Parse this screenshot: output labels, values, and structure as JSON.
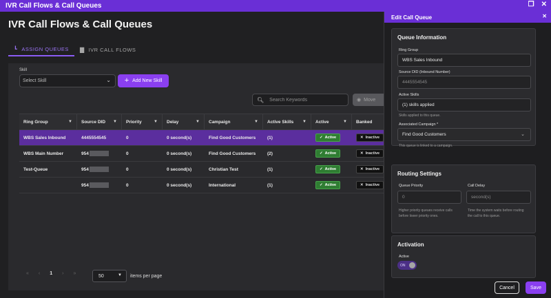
{
  "window": {
    "title": "IVR Call Flows & Call Queues",
    "restore_icon": "restore-icon",
    "close_icon": "close-icon"
  },
  "page": {
    "title": "IVR Call Flows & Call Queues"
  },
  "tabs": [
    {
      "label": "ASSIGN QUEUES",
      "icon": "chart-icon",
      "active": true
    },
    {
      "label": "IVR CALL FLOWS",
      "icon": "bar-chart-icon",
      "active": false
    }
  ],
  "filters": {
    "skill_label": "Skill",
    "skill_placeholder": "Select Skill",
    "add_skill_label": "Add New Skill",
    "search_placeholder": "Search Keywords",
    "partial_button_label": "Move"
  },
  "table": {
    "columns": [
      "Ring Group",
      "Source DID",
      "Priority",
      "Delay",
      "Campaign",
      "Active Skills",
      "Active",
      "Banked"
    ],
    "rows": [
      {
        "ring_group": "WBS Sales Inbound",
        "source_did": "4445554545",
        "priority": "0",
        "delay": "0 second(s)",
        "campaign": "Find Good Customers",
        "active_skills": "(1)",
        "active": "Active",
        "banked": "Inactive",
        "selected": true,
        "masked": false
      },
      {
        "ring_group": "WBS Main Number",
        "source_did": "954",
        "priority": "0",
        "delay": "0 second(s)",
        "campaign": "Find Good Customers",
        "active_skills": "(2)",
        "active": "Active",
        "banked": "Inactive",
        "selected": false,
        "masked": true
      },
      {
        "ring_group": "Test-Queue",
        "source_did": "954",
        "priority": "0",
        "delay": "0 second(s)",
        "campaign": "Christian Test",
        "active_skills": "(1)",
        "active": "Active",
        "banked": "Inactive",
        "selected": false,
        "masked": true
      },
      {
        "ring_group": "",
        "source_did": "954",
        "priority": "0",
        "delay": "0 second(s)",
        "campaign": "International",
        "active_skills": "(1)",
        "active": "Active",
        "banked": "Inactive",
        "selected": false,
        "masked": true
      }
    ]
  },
  "pager": {
    "first": "«",
    "prev": "‹",
    "current": "1",
    "next": "›",
    "last": "»",
    "per_page_value": "50",
    "per_page_label": "items per page"
  },
  "panel": {
    "title": "Edit Call Queue",
    "queue_info": {
      "heading": "Queue Information",
      "ring_group_label": "Ring Group",
      "ring_group_value": "WBS Sales Inbound",
      "source_did_label": "Source DID (Inbound Number)",
      "source_did_value": "4445554545",
      "active_skills_label": "Active Skills",
      "active_skills_value": "(1) skills applied",
      "active_skills_hint": "Skills applied to this queue.",
      "campaign_label": "Associated Campaign *",
      "campaign_value": "Find Good Customers",
      "campaign_hint": "This queue is linked to a campaign."
    },
    "routing": {
      "heading": "Routing Settings",
      "priority_label": "Queue Priority",
      "priority_value": "0",
      "priority_hint_1": "Higher priority queues receive calls",
      "priority_hint_2": "before lower priority ones.",
      "delay_label": "Call Delay",
      "delay_placeholder": "second(s)",
      "delay_hint_1": "Time the system waits before routing",
      "delay_hint_2": "the call to this queue."
    },
    "activation": {
      "heading": "Activation",
      "active_label": "Active",
      "toggle_text": "ON"
    },
    "cancel_label": "Cancel",
    "save_label": "Save"
  },
  "colors": {
    "brand": "#6a2fd6",
    "accent": "#8a3ff0",
    "selected_row": "#5b2e9e",
    "active_green": "#2f7d32"
  }
}
